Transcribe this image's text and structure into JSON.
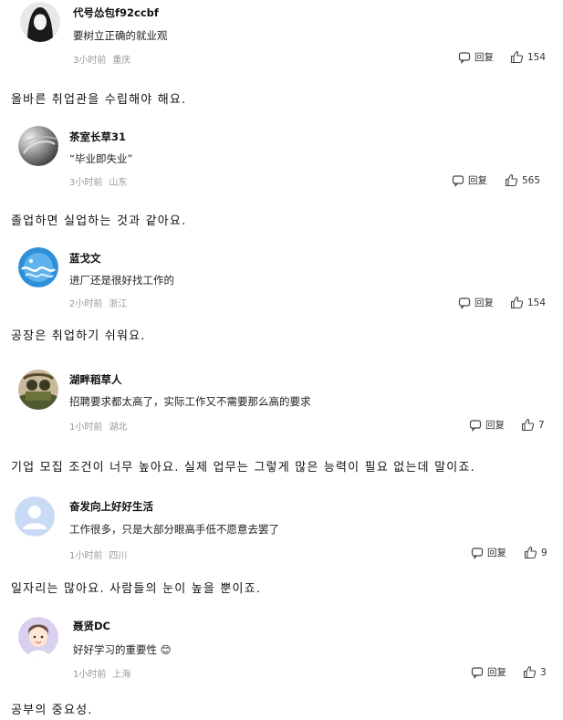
{
  "labels": {
    "reply": "回复"
  },
  "comments": [
    {
      "user": "代号怂包f92ccbf",
      "text": "要树立正确的就业观",
      "time": "3小时前",
      "location": "重庆",
      "likes": "154",
      "avatar": "anime-girl-avatar"
    },
    {
      "user": "茶室长草31",
      "text": "“毕业即失业”",
      "time": "3小时前",
      "location": "山东",
      "likes": "565",
      "avatar": "gray-swirl-avatar"
    },
    {
      "user": "蓝戈文",
      "text": "进厂还是很好找工作的",
      "time": "2小时前",
      "location": "浙江",
      "likes": "154",
      "avatar": "blue-wave-avatar"
    },
    {
      "user": "湖畔稻草人",
      "text": "招聘要求都太高了，实际工作又不需要那么高的要求",
      "time": "1小时前",
      "location": "湖北",
      "likes": "7",
      "avatar": "soldier-photo-avatar"
    },
    {
      "user": "奋发向上好好生活",
      "text": "工作很多，只是大部分眼高手低不愿意去罢了",
      "time": "1小时前",
      "location": "四川",
      "likes": "9",
      "avatar": "default-user-avatar"
    },
    {
      "user": "聂贤DC",
      "text": "好好学习的重要性 😊",
      "time": "1小时前",
      "location": "上海",
      "likes": "3",
      "avatar": "cartoon-boy-avatar"
    }
  ],
  "translations": [
    "올바른 취업관을 수립해야 해요.",
    "졸업하면 실업하는 것과 같아요.",
    "공장은 취업하기 쉬워요.",
    "기업 모집 조건이 너무 높아요. 실제 업무는 그렇게 많은 능력이 필요 없는데 말이죠.",
    "일자리는 많아요. 사람들의 눈이 높을 뿐이죠.",
    "공부의 중요성."
  ]
}
